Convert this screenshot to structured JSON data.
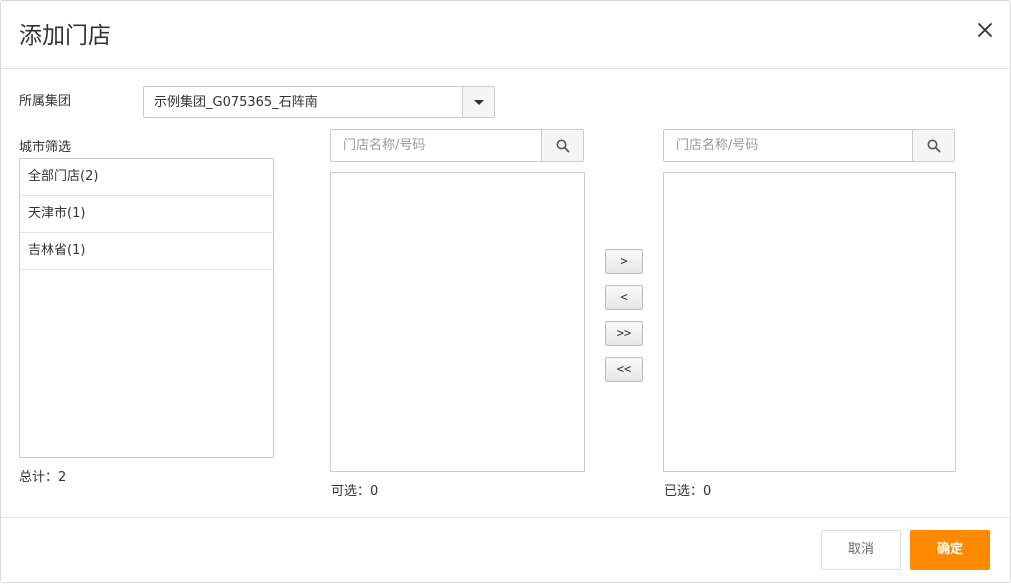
{
  "dialog": {
    "title": "添加门店",
    "close_icon": "close-icon"
  },
  "group": {
    "label": "所属集团",
    "selected": "示例集团_G075365_石阵南"
  },
  "city_filter": {
    "label": "城市筛选",
    "items": [
      {
        "label": "全部门店(2)"
      },
      {
        "label": "天津市(1)"
      },
      {
        "label": "吉林省(1)"
      }
    ],
    "total": "总计：2"
  },
  "available": {
    "placeholder": "门店名称/号码",
    "count": "可选：0"
  },
  "selected_stores": {
    "placeholder": "门店名称/号码",
    "count": "已选：0"
  },
  "move_buttons": {
    "add": ">",
    "remove": "<",
    "add_all": ">>",
    "remove_all": "<<"
  },
  "footer": {
    "cancel": "取消",
    "ok": "确定"
  },
  "colors": {
    "primary": "#ff8a00",
    "border": "#cccccc"
  }
}
